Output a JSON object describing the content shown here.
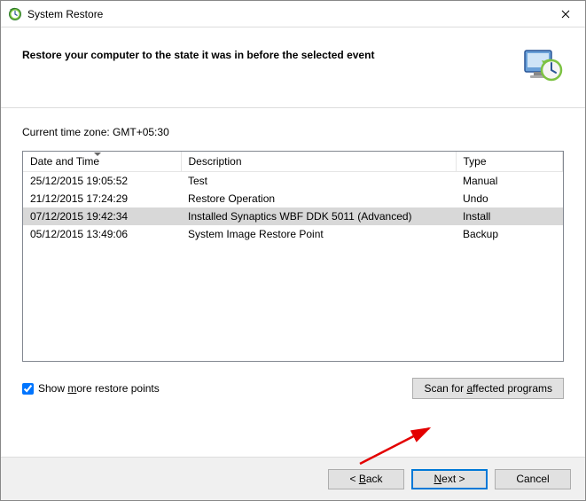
{
  "window": {
    "title": "System Restore"
  },
  "header": {
    "heading": "Restore your computer to the state it was in before the selected event"
  },
  "content": {
    "timezone_label": "Current time zone: GMT+05:30",
    "columns": {
      "date_time": "Date and Time",
      "description": "Description",
      "type": "Type"
    },
    "rows": [
      {
        "dt": "25/12/2015 19:05:52",
        "desc": "Test",
        "type": "Manual",
        "selected": false
      },
      {
        "dt": "21/12/2015 17:24:29",
        "desc": "Restore Operation",
        "type": "Undo",
        "selected": false
      },
      {
        "dt": "07/12/2015 19:42:34",
        "desc": "Installed Synaptics WBF DDK 5011 (Advanced)",
        "type": "Install",
        "selected": true
      },
      {
        "dt": "05/12/2015 13:49:06",
        "desc": "System Image Restore Point",
        "type": "Backup",
        "selected": false
      }
    ],
    "show_more_label": "Show more restore points",
    "show_more_checked": true,
    "scan_button": "Scan for affected programs"
  },
  "footer": {
    "back": "< Back",
    "next": "Next >",
    "cancel": "Cancel"
  }
}
